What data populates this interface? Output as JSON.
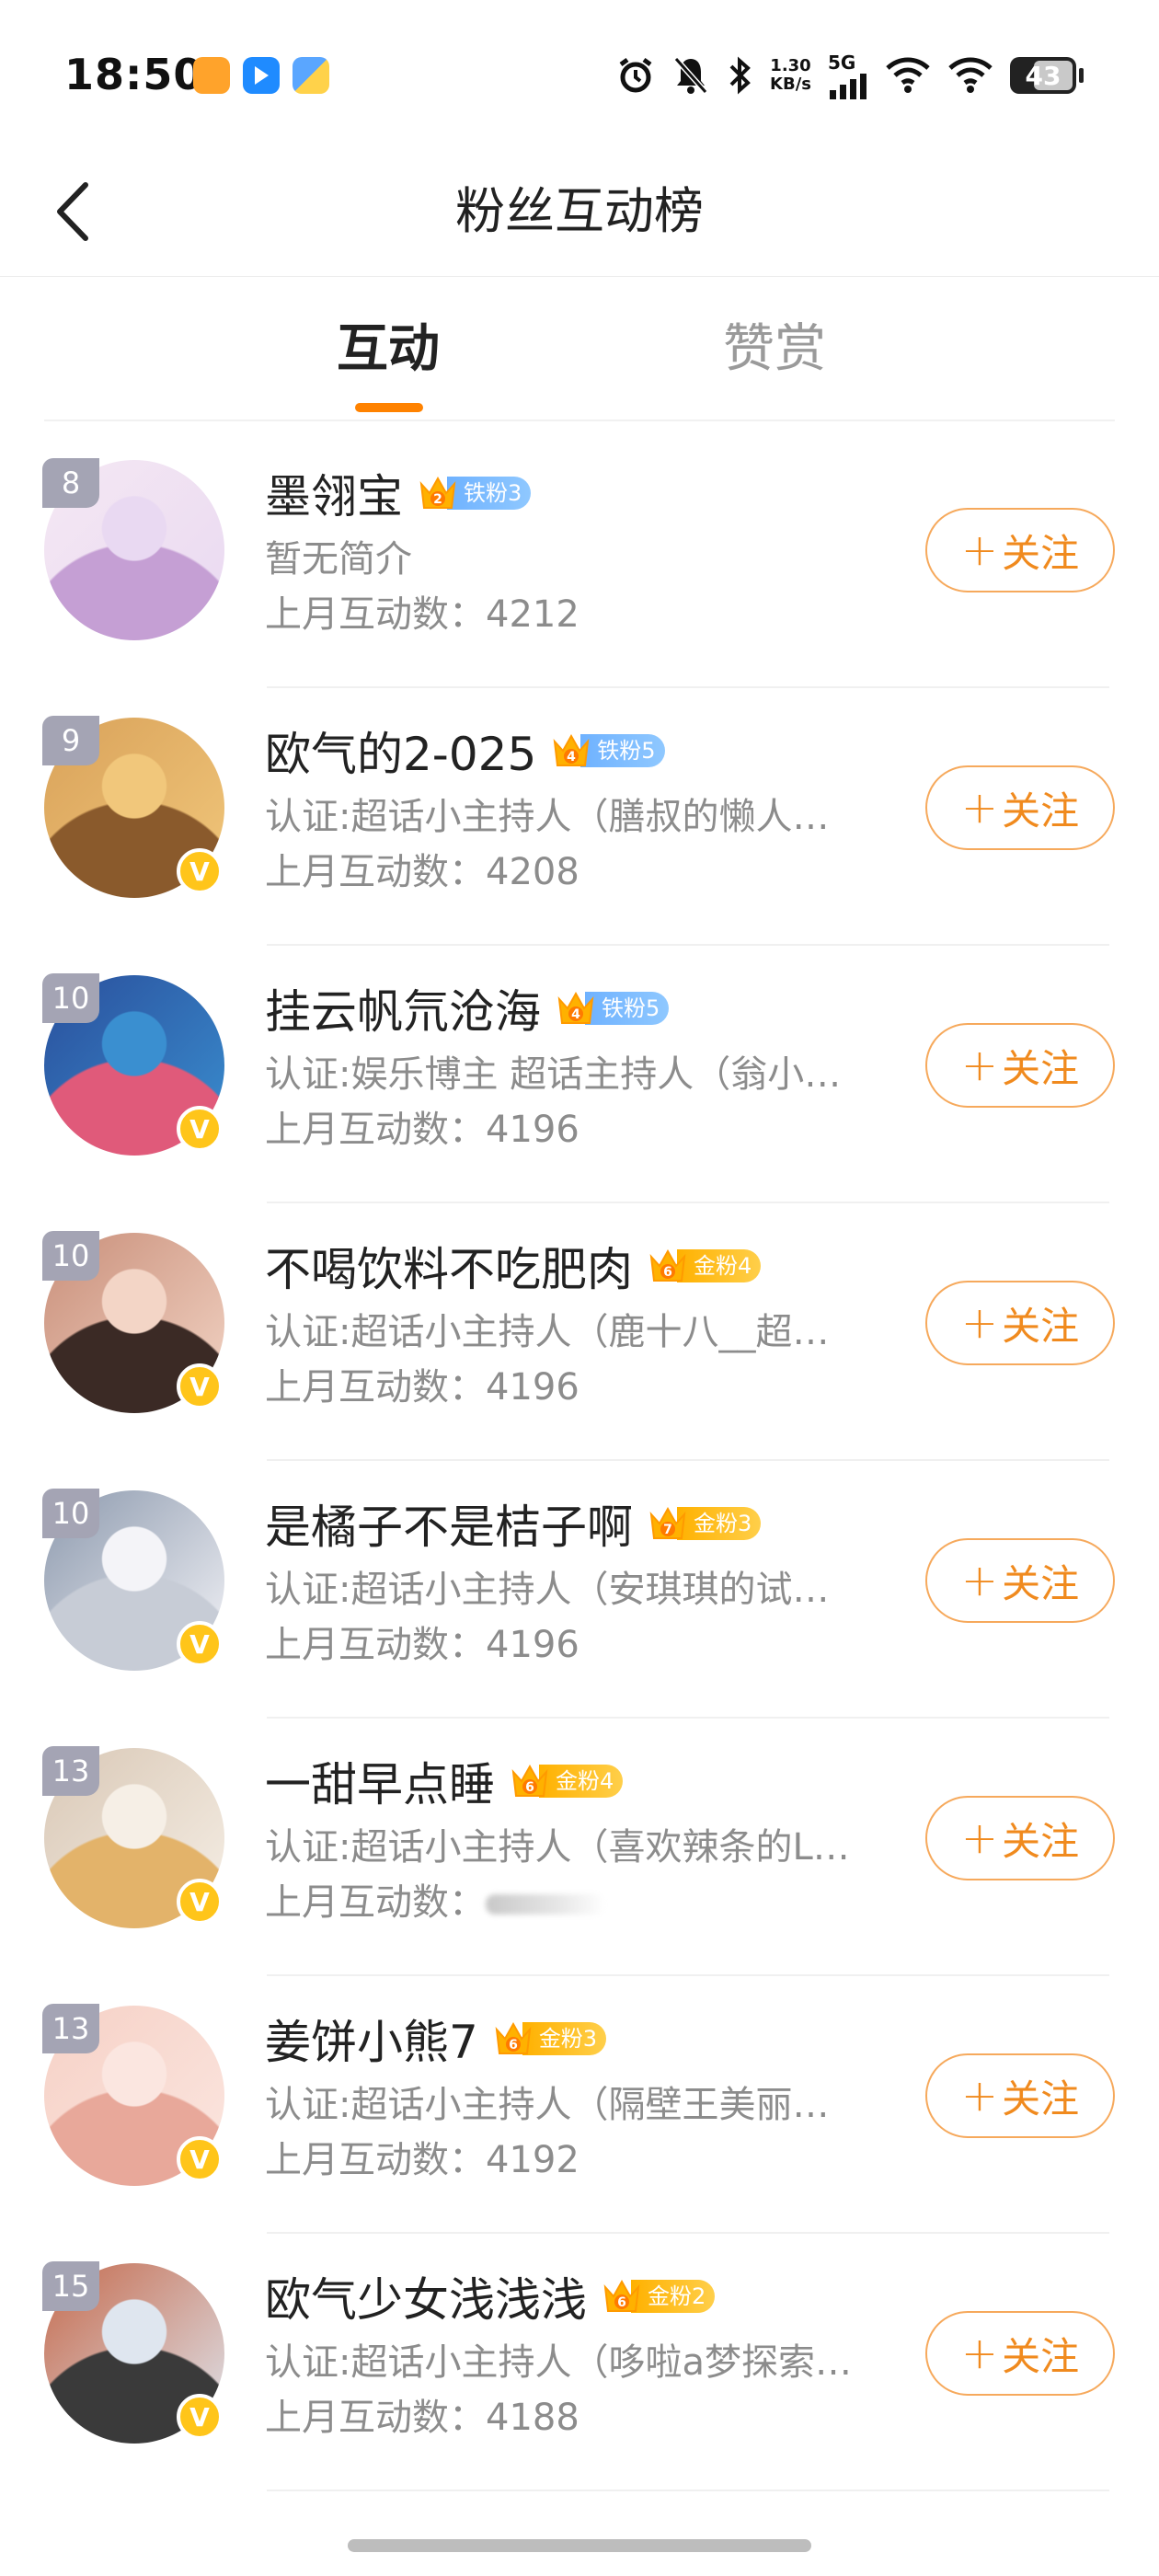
{
  "status_bar": {
    "time": "18:50",
    "speed_value": "1.30",
    "speed_unit": "KB/s",
    "network": "5G",
    "battery": "43",
    "app_icons": [
      "orange-app-icon",
      "blue-arrow-app-icon",
      "blue-yellow-app-icon"
    ],
    "icons": [
      "alarm-icon",
      "mute-icon",
      "bluetooth-icon",
      "signal-icon",
      "wifi-icon",
      "wifi-icon",
      "battery-icon"
    ]
  },
  "nav": {
    "title": "粉丝互动榜",
    "back_icon": "chevron-left-icon"
  },
  "tabs": [
    {
      "label": "互动",
      "active": true
    },
    {
      "label": "赞赏",
      "active": false
    }
  ],
  "colors": {
    "accent": "#ff8200",
    "follow_text": "#f08a1e",
    "follow_border": "#f6a95c",
    "iron_badge": "#6fb2ff",
    "gold_badge": "#ffb100",
    "verified": "#ffc51a",
    "rank_bg": "#a4a4b4"
  },
  "list": [
    {
      "rank": "8",
      "name": "墨翎宝",
      "badge_type": "iron",
      "badge_level": "2",
      "badge_label": "铁粉3",
      "desc": "暂无简介",
      "count_label": "上月互动数：",
      "count": "4212",
      "verified": false,
      "follow_label": "关注",
      "avatar_colors": [
        "#e9d9f2",
        "#c59fd4",
        "#f5e8f3"
      ]
    },
    {
      "rank": "9",
      "name": "欧气的2-025",
      "badge_type": "iron",
      "badge_level": "4",
      "badge_label": "铁粉5",
      "desc": "认证:超话小主持人（膳叔的懒人…",
      "count_label": "上月互动数：",
      "count": "4208",
      "verified": true,
      "follow_label": "关注",
      "avatar_colors": [
        "#f1c77b",
        "#8a5a2c",
        "#d9a25a"
      ]
    },
    {
      "rank": "10",
      "name": "挂云帆氘沧海",
      "badge_type": "iron",
      "badge_level": "4",
      "badge_label": "铁粉5",
      "desc": "认证:娱乐博主 超话主持人（翁小…",
      "count_label": "上月互动数：",
      "count": "4196",
      "verified": true,
      "follow_label": "关注",
      "avatar_colors": [
        "#3a8fd0",
        "#e05a7a",
        "#2a4f9c"
      ]
    },
    {
      "rank": "10",
      "name": "不喝饮料不吃肥肉",
      "badge_type": "gold",
      "badge_level": "6",
      "badge_label": "金粉4",
      "desc": "认证:超话小主持人（鹿十八__超…",
      "count_label": "上月互动数：",
      "count": "4196",
      "verified": true,
      "follow_label": "关注",
      "avatar_colors": [
        "#f3d5c6",
        "#3b2a25",
        "#c98f7a"
      ]
    },
    {
      "rank": "10",
      "name": "是橘子不是桔子啊",
      "badge_type": "gold",
      "badge_level": "7",
      "badge_label": "金粉3",
      "desc": "认证:超话小主持人（安琪琪的试…",
      "count_label": "上月互动数：",
      "count": "4196",
      "verified": true,
      "follow_label": "关注",
      "avatar_colors": [
        "#f4f4f8",
        "#c7ccd6",
        "#8d9aae"
      ]
    },
    {
      "rank": "13",
      "name": "一甜早点睡",
      "badge_type": "gold",
      "badge_level": "6",
      "badge_label": "金粉4",
      "desc": "认证:超话小主持人（喜欢辣条的L…",
      "count_label": "上月互动数：",
      "count": "",
      "count_blurred": true,
      "verified": true,
      "follow_label": "关注",
      "avatar_colors": [
        "#f6efe6",
        "#e3b36a",
        "#d9c8b6"
      ]
    },
    {
      "rank": "13",
      "name": "姜饼小熊7",
      "badge_type": "gold",
      "badge_level": "6",
      "badge_label": "金粉3",
      "desc": "认证:超话小主持人（隔壁王美丽…",
      "count_label": "上月互动数：",
      "count": "4192",
      "verified": true,
      "follow_label": "关注",
      "avatar_colors": [
        "#fbe6e0",
        "#e8a89a",
        "#f6d1c6"
      ]
    },
    {
      "rank": "15",
      "name": "欧气少女浅浅浅",
      "badge_type": "gold",
      "badge_level": "6",
      "badge_label": "金粉2",
      "desc": "认证:超话小主持人（哆啦a梦探索…",
      "count_label": "上月互动数：",
      "count": "4188",
      "verified": true,
      "follow_label": "关注",
      "avatar_colors": [
        "#dfe6ef",
        "#3a3a3a",
        "#c56b4e"
      ]
    }
  ]
}
